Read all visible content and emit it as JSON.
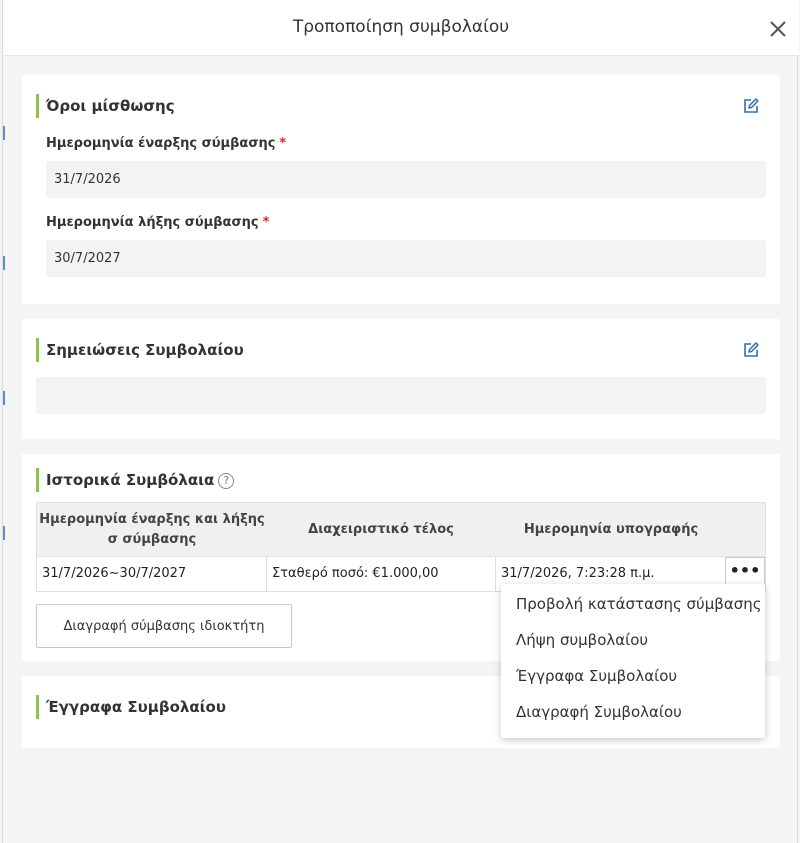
{
  "dialog": {
    "title": "Τροποποίηση συμβολαίου",
    "close_label": "×"
  },
  "lease_terms": {
    "title": "Όροι μίσθωσης",
    "start_label": "Ημερομηνία έναρξης σύμβασης",
    "start_value": "31/7/2026",
    "end_label": "Ημερομηνία λήξης σύμβασης",
    "end_value": "30/7/2027",
    "required_mark": "*"
  },
  "notes": {
    "title": "Σημειώσεις Συμβολαίου",
    "value": ""
  },
  "history": {
    "title": "Ιστορικά Συμβόλαια",
    "help_glyph": "?",
    "columns": [
      "Ημερομηνία έναρξης και λήξης σ σύμβασης",
      "Διαχειριστικό τέλος",
      "Ημερομηνία υπογραφής"
    ],
    "rows": [
      {
        "period": "31/7/2026~30/7/2027",
        "fee": "Σταθερό ποσό: €1.000,00",
        "signed": "31/7/2026, 7:23:28 π.μ."
      }
    ],
    "more_label": "•••",
    "delete_button": "Διαγραφή σύμβασης ιδιοκτήτη"
  },
  "documents": {
    "title": "Έγγραφα Συμβολαίου"
  },
  "context_menu": {
    "items": [
      "Προβολή κατάστασης σύμβασης",
      "Λήψη συμβολαίου",
      "Έγγραφα Συμβολαίου",
      "Διαγραφή Συμβολαίου"
    ]
  },
  "colors": {
    "accent_bar": "#8cc34a",
    "edit_icon": "#2f6fb3",
    "required": "#d9272e"
  },
  "icons": {
    "close": "close-icon",
    "edit": "edit-icon",
    "help": "help-icon",
    "more": "more-horizontal-icon"
  }
}
